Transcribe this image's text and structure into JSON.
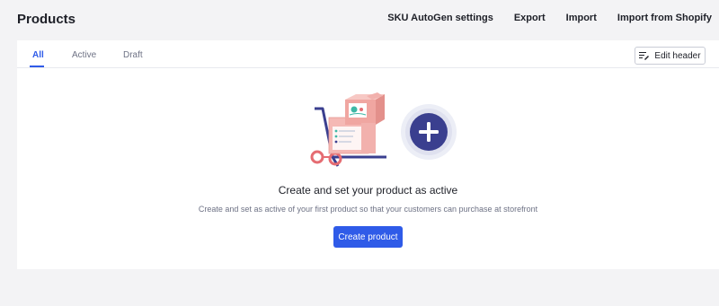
{
  "header": {
    "title": "Products",
    "actions": [
      "SKU AutoGen settings",
      "Export",
      "Import",
      "Import from Shopify"
    ]
  },
  "tabs": [
    {
      "label": "All",
      "active": true
    },
    {
      "label": "Active",
      "active": false
    },
    {
      "label": "Draft",
      "active": false
    }
  ],
  "edit_header": {
    "label": "Edit header",
    "icon": "edit-columns-icon"
  },
  "empty_state": {
    "title": "Create and set your product as active",
    "description": "Create and set as active of your first product so that your customers can purchase at storefront",
    "button_label": "Create product",
    "illustration": "hand-truck-with-boxes-and-plus-icon"
  },
  "colors": {
    "accent": "#2f5be8",
    "page_bg": "#f3f3f5",
    "card_bg": "#ffffff",
    "box_pink": "#f2a9a6",
    "plus_circle": "#3a3f8f"
  }
}
